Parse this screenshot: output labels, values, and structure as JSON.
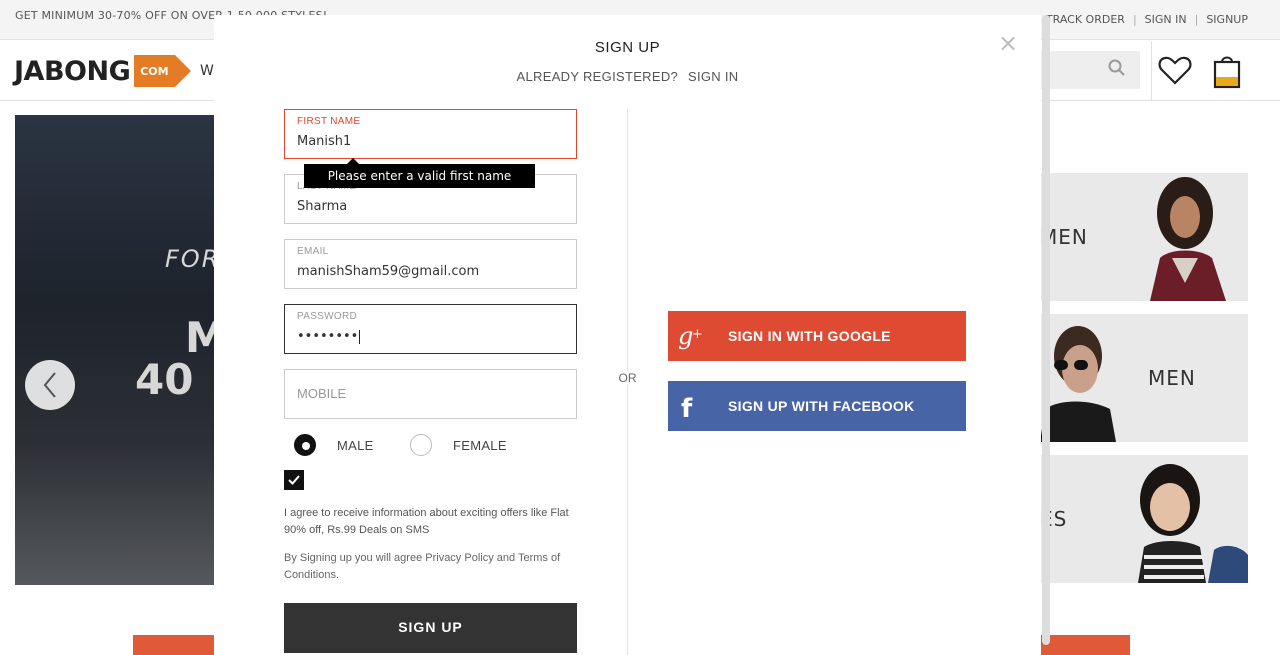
{
  "background": {
    "promo": "GET MINIMUM 30-70% OFF ON OVER 1,50,000 STYLES!",
    "toplinks": [
      "TRACK ORDER",
      "SIGN IN",
      "SIGNUP"
    ],
    "logo": {
      "text": "JABONG",
      "badge": "COM"
    },
    "nav_partial": "W",
    "hero": {
      "line1": "FORE",
      "line2": "M",
      "line3": "40"
    },
    "categories": [
      {
        "label": "MEN",
        "partial": "MEN"
      },
      {
        "label": "MEN"
      },
      {
        "label": "ES"
      }
    ],
    "colors": {
      "brand": "#e47b25"
    }
  },
  "modal": {
    "title": "SIGN UP",
    "already_text": "ALREADY REGISTERED?",
    "signin_link": "SIGN IN",
    "close": "×",
    "fields": {
      "first_name": {
        "label": "FIRST NAME",
        "value": "Manish1"
      },
      "last_name": {
        "label": "LAST NAME",
        "value": "Sharma"
      },
      "email": {
        "label": "EMAIL",
        "value": "manishSham59@gmail.com"
      },
      "password": {
        "label": "PASSWORD",
        "value": "••••••••"
      },
      "mobile": {
        "placeholder": "MOBILE"
      }
    },
    "tooltip": "Please enter a valid first name",
    "gender": {
      "male": "MALE",
      "female": "FEMALE",
      "selected": "MALE"
    },
    "agree_checked": true,
    "agree_text": "I agree to receive information about exciting offers like Flat 90% off, Rs.99 Deals on SMS",
    "terms_text": "By Signing up you will agree Privacy Policy and Terms of Conditions.",
    "signup_button": "SIGN UP",
    "or_text": "OR",
    "google_button": "SIGN IN WITH GOOGLE",
    "facebook_button": "SIGN UP WITH FACEBOOK",
    "colors": {
      "google": "#df4a32",
      "facebook": "#4764a7",
      "error": "#e0452e",
      "button": "#333333"
    }
  }
}
